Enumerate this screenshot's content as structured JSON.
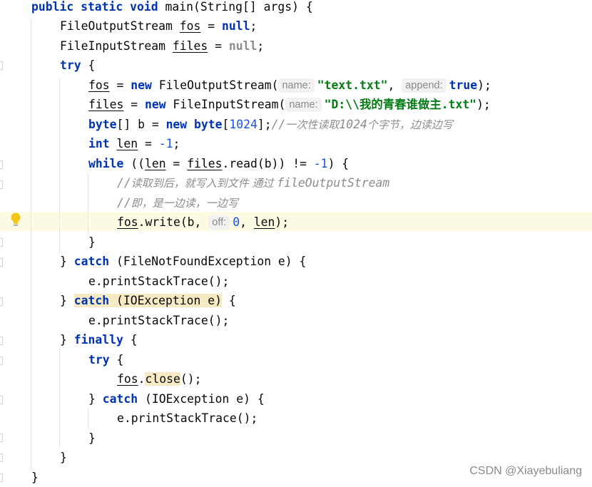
{
  "code": {
    "l1": {
      "kw": "public static void",
      "rest": " main(String[] args) {"
    },
    "l2": {
      "type": "FileOutputStream ",
      "var": "fos",
      "eq": " = ",
      "kw": "null",
      "semi": ";"
    },
    "l3": {
      "type": "FileInputStream ",
      "var": "files",
      "eq": " = ",
      "kw": "null",
      "semi": ";"
    },
    "l4": {
      "kw": "try",
      "rest": " {"
    },
    "l5": {
      "var": "fos",
      "mid": " = ",
      "kw": "new",
      "call": " FileOutputStream(",
      "hint_name": "name:",
      "str": "\"text.txt\"",
      "comma": ", ",
      "hint_append": "append:",
      "kw2": "true",
      "end": ");"
    },
    "l6": {
      "var": "files",
      "mid": " = ",
      "kw": "new",
      "call": " FileInputStream(",
      "hint_name": "name:",
      "str_path": "\"D:\\\\我的青春谁做主.txt\"",
      "end": ");"
    },
    "l7": {
      "kw": "byte",
      "mid": "[] b = ",
      "kw2": "new",
      "sp": " ",
      "kw3": "byte",
      "lb": "[",
      "num": "1024",
      "rb": "];",
      "cmt_slash": "//",
      "cmt_a": "一次性读取",
      "cmt_num": "1024",
      "cmt_b": "个字节，边读边写"
    },
    "l8": {
      "kw": "int",
      "sp": " ",
      "var": "len",
      "mid": " = ",
      "num": "-1",
      "semi": ";"
    },
    "l9": {
      "kw": "while",
      "p1": " ((",
      "var": "len",
      "p2": " = ",
      "var2": "files",
      "p3": ".read(b)) != ",
      "num": "-1",
      "p4": ") {"
    },
    "l10": {
      "slash": "//",
      "a": "读取到后，就写入到文件 通过 ",
      "b": "fileOutputStream"
    },
    "l11": {
      "slash": "//",
      "a": "即，是一边读，一边写"
    },
    "l12": {
      "var": "fos",
      "call": ".write(b, ",
      "hint_off": "off:",
      "num": "0",
      "comma": ", ",
      "var2": "len",
      "end": ");"
    },
    "l13": {
      "brace": "}"
    },
    "l14": {
      "pre": "} ",
      "kw": "catch",
      "rest": " (FileNotFoundException e) {"
    },
    "l15": {
      "text": "e.printStackTrace();"
    },
    "l16": {
      "pre": "} ",
      "kw": "catch",
      "rest": " (IOException e)",
      "post": " {"
    },
    "l17": {
      "text": "e.printStackTrace();"
    },
    "l18": {
      "pre": "} ",
      "kw": "finally",
      "rest": " {"
    },
    "l19": {
      "kw": "try",
      "rest": " {"
    },
    "l20": {
      "var": "fos",
      "dot": ".",
      "method": "close",
      "end": "();"
    },
    "l21": {
      "pre": "} ",
      "kw": "catch",
      "rest": " (IOException e) {"
    },
    "l22": {
      "text": "e.printStackTrace();"
    },
    "l23": {
      "brace": "}"
    },
    "l24": {
      "brace": "}"
    },
    "l25": {
      "brace": "}"
    }
  },
  "watermark": "CSDN @Xiayebuliang",
  "colors": {
    "keyword": "#0033b3",
    "string": "#067d17",
    "number": "#1750eb",
    "comment": "#8c8c8c",
    "highlight_line": "#fcfae3",
    "bulb": "#f5c518"
  },
  "icons": [
    "intention-bulb-icon",
    "fold-marker-icon"
  ]
}
